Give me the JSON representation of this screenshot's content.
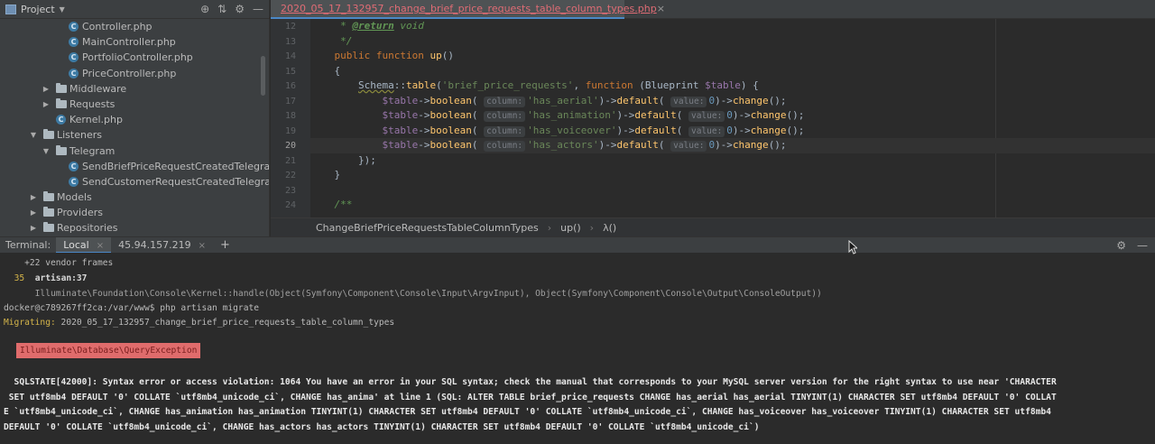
{
  "project_panel": {
    "title": "Project",
    "tree": [
      {
        "label": "Controller.php",
        "type": "class",
        "indent": 76,
        "arrow": ""
      },
      {
        "label": "MainController.php",
        "type": "class",
        "indent": 76,
        "arrow": ""
      },
      {
        "label": "PortfolioController.php",
        "type": "class",
        "indent": 76,
        "arrow": ""
      },
      {
        "label": "PriceController.php",
        "type": "class",
        "indent": 76,
        "arrow": ""
      },
      {
        "label": "Middleware",
        "type": "folder",
        "indent": 62,
        "arrow": "▶"
      },
      {
        "label": "Requests",
        "type": "folder",
        "indent": 62,
        "arrow": "▶"
      },
      {
        "label": "Kernel.php",
        "type": "class",
        "indent": 62,
        "arrow": ""
      },
      {
        "label": "Listeners",
        "type": "folder",
        "indent": 48,
        "arrow": "▼"
      },
      {
        "label": "Telegram",
        "type": "folder",
        "indent": 62,
        "arrow": "▼"
      },
      {
        "label": "SendBriefPriceRequestCreatedTelegramNoti",
        "type": "class",
        "indent": 76,
        "arrow": ""
      },
      {
        "label": "SendCustomerRequestCreatedTelegramNot",
        "type": "class",
        "indent": 76,
        "arrow": ""
      },
      {
        "label": "Models",
        "type": "folder",
        "indent": 48,
        "arrow": "▶"
      },
      {
        "label": "Providers",
        "type": "folder",
        "indent": 48,
        "arrow": "▶"
      },
      {
        "label": "Repositories",
        "type": "folder",
        "indent": 48,
        "arrow": "▶"
      }
    ]
  },
  "editor": {
    "tab_title": "2020_05_17_132957_change_brief_price_requests_table_column_types.php",
    "tab_close": "×",
    "current_line": 20,
    "lines": [
      {
        "n": 12,
        "html_key": "l12"
      },
      {
        "n": 13,
        "html_key": "l13"
      },
      {
        "n": 14,
        "html_key": "l14"
      },
      {
        "n": 15,
        "html_key": "l15"
      },
      {
        "n": 16,
        "html_key": "l16"
      },
      {
        "n": 17,
        "html_key": "l17"
      },
      {
        "n": 18,
        "html_key": "l18"
      },
      {
        "n": 19,
        "html_key": "l19"
      },
      {
        "n": 20,
        "html_key": "l20"
      },
      {
        "n": 21,
        "html_key": "l21"
      },
      {
        "n": 22,
        "html_key": "l22"
      },
      {
        "n": 23,
        "html_key": "l23"
      },
      {
        "n": 24,
        "html_key": "l24"
      }
    ],
    "code": {
      "return_tag": "@return",
      "return_type": " void",
      "doc_close": "*/",
      "public": "public",
      "function": "function",
      "up": "up",
      "schema": "Schema",
      "table_method": "table",
      "table_name": "'brief_price_requests'",
      "blueprint": "Blueprint",
      "table_var": "$table",
      "boolean": "boolean",
      "default": "default",
      "change": "change",
      "hint_column": "column:",
      "hint_value": "value:",
      "zero": "0",
      "columns": [
        "'has_aerial'",
        "'has_animation'",
        "'has_voiceover'",
        "'has_actors'"
      ],
      "close_schema": "});",
      "close_brace": "}",
      "open_brace": "{",
      "doc_open": "/**"
    },
    "breadcrumbs": [
      "ChangeBriefPriceRequestsTableColumnTypes",
      "up()",
      "λ()"
    ]
  },
  "terminal_bar": {
    "label": "Terminal:",
    "tabs": [
      "Local",
      "45.94.157.219"
    ],
    "close": "×",
    "add": "+"
  },
  "terminal": {
    "vendor_frames": "    +22 vendor frames",
    "frame_num": "35",
    "frame_file": "artisan:37",
    "frame_call": "      Illuminate\\Foundation\\Console\\Kernel::handle(Object(Symfony\\Component\\Console\\Input\\ArgvInput), Object(Symfony\\Component\\Console\\Output\\ConsoleOutput))",
    "prompt": "docker@c789267ff2ca:/var/www$ php artisan migrate",
    "migrating_label": "Migrating:",
    "migrating_file": " 2020_05_17_132957_change_brief_price_requests_table_column_types",
    "exception": "Illuminate\\Database\\QueryException",
    "error_lines": [
      "  SQLSTATE[42000]: Syntax error or access violation: 1064 You have an error in your SQL syntax; check the manual that corresponds to your MySQL server version for the right syntax to use near 'CHARACTER",
      " SET utf8mb4 DEFAULT '0' COLLATE `utf8mb4_unicode_ci`, CHANGE has_anima' at line 1 (SQL: ALTER TABLE brief_price_requests CHANGE has_aerial has_aerial TINYINT(1) CHARACTER SET utf8mb4 DEFAULT '0' COLLAT",
      "E `utf8mb4_unicode_ci`, CHANGE has_animation has_animation TINYINT(1) CHARACTER SET utf8mb4 DEFAULT '0' COLLATE `utf8mb4_unicode_ci`, CHANGE has_voiceover has_voiceover TINYINT(1) CHARACTER SET utf8mb4",
      "DEFAULT '0' COLLATE `utf8mb4_unicode_ci`, CHANGE has_actors has_actors TINYINT(1) CHARACTER SET utf8mb4 DEFAULT '0' COLLATE `utf8mb4_unicode_ci`)"
    ]
  },
  "colors": {
    "background": "#2b2b2b",
    "panel": "#3c3f41",
    "accent": "#4a88c7",
    "error_badge": "#e06c6c",
    "keyword": "#cc7832",
    "string": "#6a8759"
  }
}
